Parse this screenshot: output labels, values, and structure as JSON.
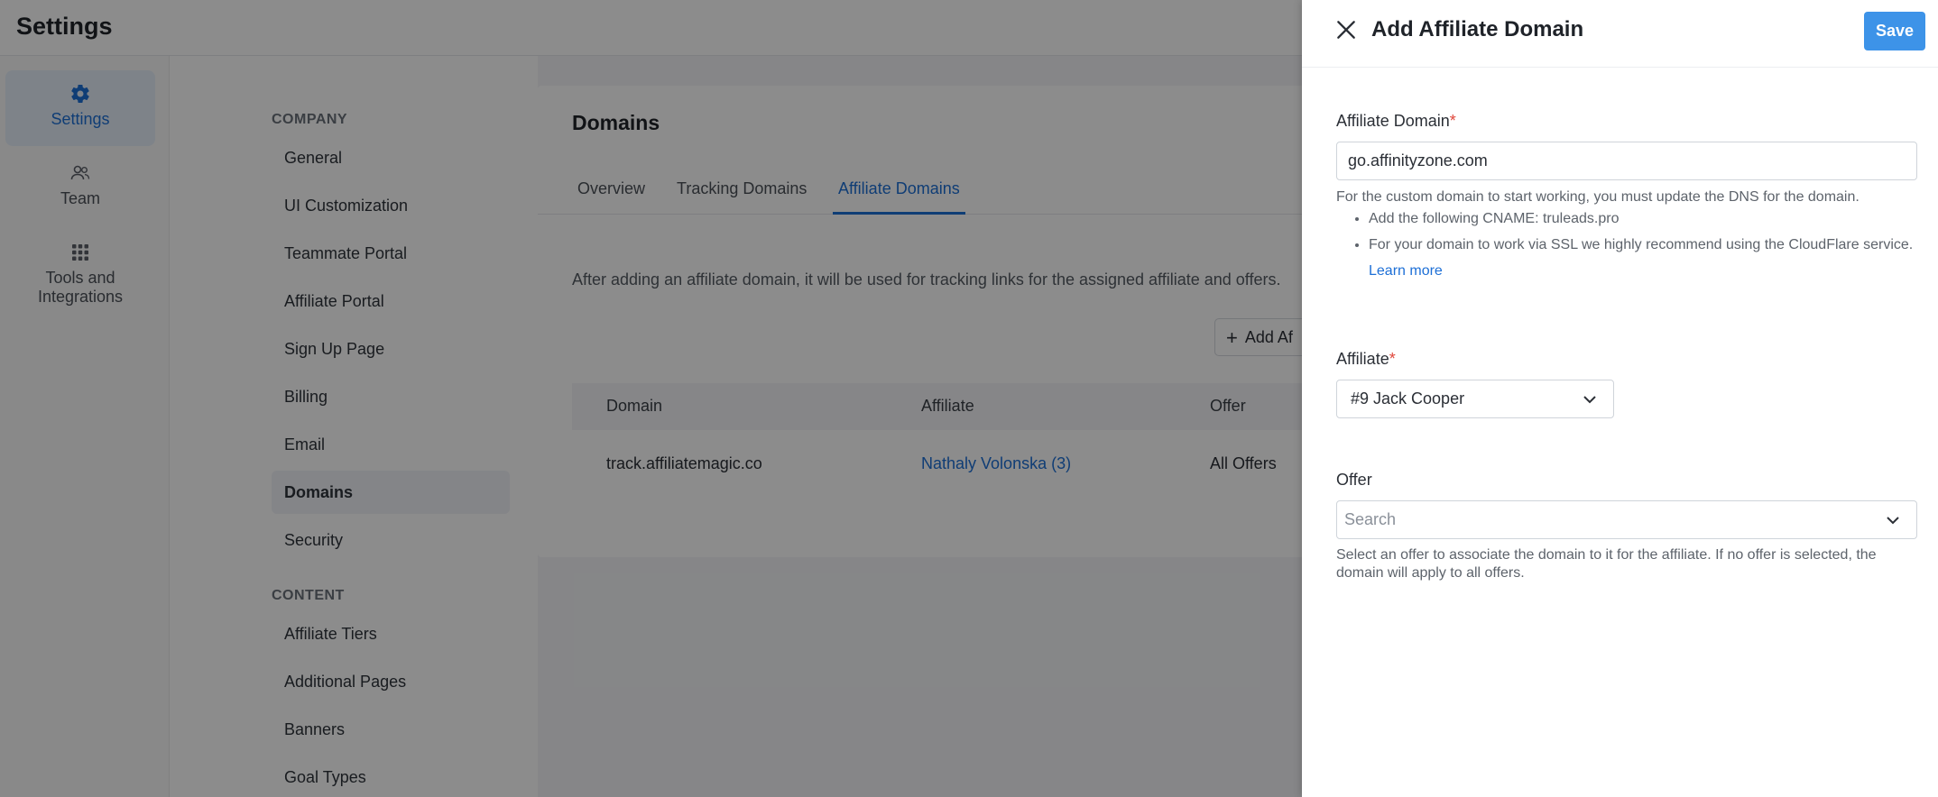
{
  "app": {
    "title": "Settings"
  },
  "rail": {
    "items": [
      {
        "label": "Settings",
        "icon": "gear-icon",
        "active": true
      },
      {
        "label": "Team",
        "icon": "users-icon",
        "active": false
      },
      {
        "label": "Tools and Integrations",
        "icon": "grid-icon",
        "active": false
      }
    ]
  },
  "nav": {
    "company_heading": "COMPANY",
    "company_items": [
      "General",
      "UI Customization",
      "Teammate Portal",
      "Affiliate Portal",
      "Sign Up Page",
      "Billing",
      "Email",
      "Domains",
      "Security"
    ],
    "active_item": "Domains",
    "content_heading": "CONTENT",
    "content_items": [
      "Affiliate Tiers",
      "Additional Pages",
      "Banners",
      "Goal Types"
    ]
  },
  "domains_page": {
    "title": "Domains",
    "tabs": [
      "Overview",
      "Tracking Domains",
      "Affiliate Domains"
    ],
    "active_tab": "Affiliate Domains",
    "description": "After adding an affiliate domain, it will be used for tracking links for the assigned affiliate and offers.",
    "add_button_label": "Add Af",
    "table": {
      "headers": [
        "Domain",
        "Affiliate",
        "Offer"
      ],
      "rows": [
        {
          "domain": "track.affiliatemagic.co",
          "affiliate": "Nathaly Volonska (3)",
          "offer": "All Offers"
        }
      ]
    }
  },
  "drawer": {
    "title": "Add Affiliate Domain",
    "save_label": "Save",
    "affiliate_domain": {
      "label": "Affiliate Domain",
      "required_mark": "*",
      "value": "go.affinityzone.com",
      "help_intro": "For the custom domain to start working, you must update the DNS for the domain.",
      "help_bullet_1": "Add the following CNAME: truleads.pro",
      "help_bullet_2": "For your domain to work via SSL we highly recommend using the CloudFlare service.",
      "learn_more": "Learn more"
    },
    "affiliate": {
      "label": "Affiliate",
      "required_mark": "*",
      "selected": "#9 Jack Cooper"
    },
    "offer": {
      "label": "Offer",
      "placeholder": "Search",
      "help": "Select an offer to associate the domain to it for the affiliate. If no offer is selected, the domain will apply to all offers."
    }
  },
  "colors": {
    "accent": "#1d6fd6",
    "save_button": "#3d93e8",
    "required": "#e0463a",
    "overlay": "rgba(0,0,0,0.45)"
  }
}
